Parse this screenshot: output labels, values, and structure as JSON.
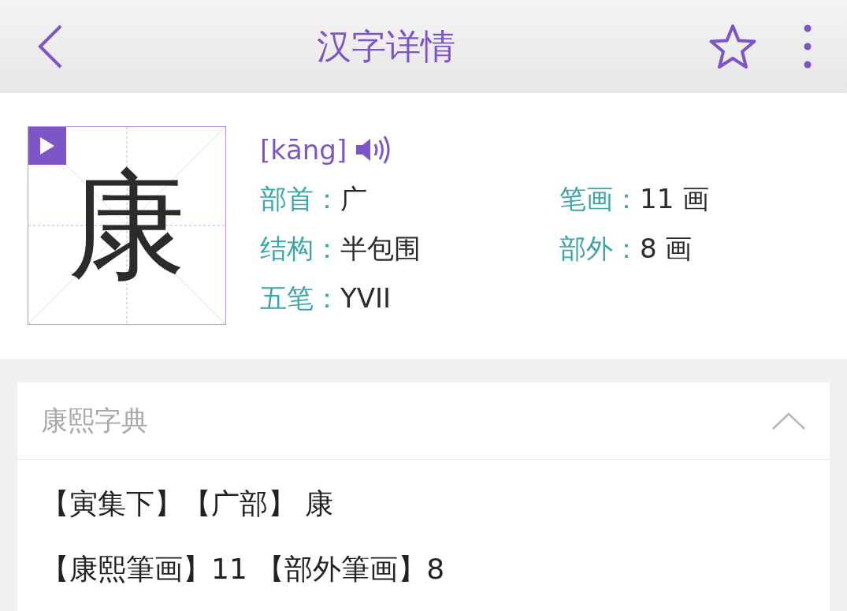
{
  "header": {
    "title": "汉字详情"
  },
  "character": {
    "glyph": "康",
    "pinyin": "[kāng]",
    "fields": [
      {
        "label": "部首：",
        "value": "广"
      },
      {
        "label": "笔画：",
        "value": "11 画"
      },
      {
        "label": "结构：",
        "value": "半包围"
      },
      {
        "label": "部外：",
        "value": "8 画"
      },
      {
        "label": "五笔：",
        "value": "YVII"
      }
    ]
  },
  "section": {
    "title": "康熙字典",
    "expanded": true,
    "lines": [
      "【寅集下】【广部】 康",
      "【康熙筆画】11 【部外筆画】8"
    ]
  }
}
